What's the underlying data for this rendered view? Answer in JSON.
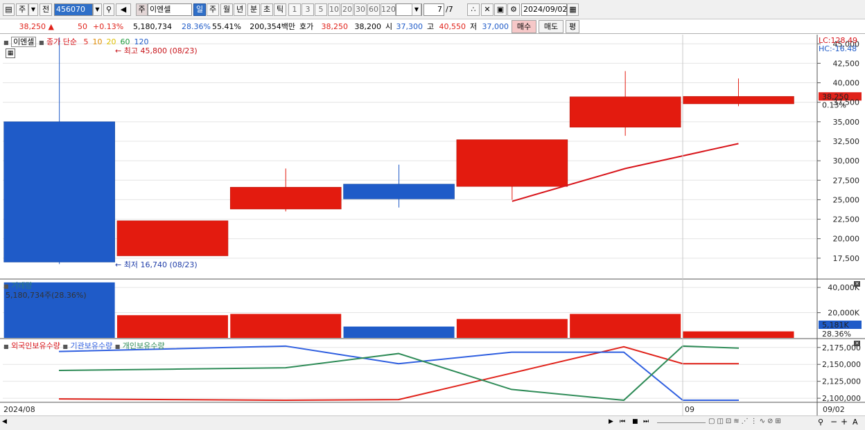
{
  "toolbar": {
    "market_mode": "주",
    "prev_label": "전",
    "stock_code": "456070",
    "stock_prefix": "주",
    "stock_name": "이엔셀",
    "periods": [
      "일",
      "주",
      "월",
      "년",
      "분",
      "초",
      "틱"
    ],
    "selected_period": "일",
    "intervals": [
      "1",
      "3",
      "5",
      "10",
      "20",
      "30",
      "60",
      "120"
    ],
    "page": "7",
    "page_total": "/7",
    "date": "2024/09/02"
  },
  "quote": {
    "price": "38,250 ▲",
    "change": "50",
    "change_pct": "+0.13%",
    "volume": "5,180,734",
    "turnover_pct": "28.36%",
    "ratio_pct": "55.41%",
    "amount": "200,354백만",
    "ask_label": "호가",
    "ask": "38,250",
    "bid": "38,200",
    "open_label": "시",
    "open": "37,300",
    "high_label": "고",
    "high": "40,550",
    "low_label": "저",
    "low": "37,000",
    "buy_label": "매수",
    "sell_label": "매도",
    "eval_label": "평"
  },
  "price_panel": {
    "stock_name": "이엔셀",
    "legend_ma": "종가 단순",
    "ma_periods": [
      "5",
      "10",
      "20",
      "60",
      "120"
    ],
    "ma_colors": [
      "#e0221a",
      "#e08a00",
      "#e0c000",
      "#1a9a3a",
      "#1f5bc8"
    ],
    "high_note": "최고 45,800 (08/23)",
    "low_note": "최저 16,740 (08/23)",
    "lc": "LC:128.49",
    "hc": "HC:-16.48",
    "last_price_tag": "38,250",
    "last_change_tag": "0.13%",
    "y_ticks": [
      "45,000",
      "42,500",
      "40,000",
      "37,500",
      "35,000",
      "32,500",
      "30,000",
      "27,500",
      "25,000",
      "22,500",
      "20,000",
      "17,500"
    ]
  },
  "volume_panel": {
    "title": "거래량",
    "info": "5,180,734주(28.36%)",
    "y_ticks": [
      "40,000K",
      "20,000K"
    ],
    "last_tag": "5,181K",
    "last_pct": "28.36%"
  },
  "holding_panel": {
    "legend": [
      "외국인보유수량",
      "기관보유수량",
      "개인보유수량"
    ],
    "y_ticks": [
      "2,175,000",
      "2,150,000",
      "2,125,000",
      "2,100,000"
    ]
  },
  "x_axis": {
    "left_label": "2024/08",
    "mid_label": "09",
    "right_label": "09/02"
  },
  "colors": {
    "up": "#e31b0f",
    "down": "#1f5bc8",
    "foreign": "#e0221a",
    "inst": "#2f5fe0",
    "indiv": "#2e8b57",
    "ma5": "#d8141a"
  },
  "chart_data": [
    {
      "type": "candlestick",
      "title": "이엔셀",
      "ylim": [
        15000,
        46000
      ],
      "candles": [
        {
          "open": 35000,
          "close": 17000,
          "high": 45800,
          "low": 16740
        },
        {
          "open": 17800,
          "close": 22300,
          "high": 22300,
          "low": 17800
        },
        {
          "open": 23800,
          "close": 26600,
          "high": 29000,
          "low": 23500
        },
        {
          "open": 27000,
          "close": 25100,
          "high": 29500,
          "low": 24000
        },
        {
          "open": 26700,
          "close": 32700,
          "high": 32700,
          "low": 25000
        },
        {
          "open": 34300,
          "close": 38200,
          "high": 41500,
          "low": 33200
        },
        {
          "open": 37300,
          "close": 38250,
          "high": 40550,
          "low": 37000
        }
      ],
      "ma5": [
        null,
        null,
        null,
        null,
        24800,
        29000,
        32200
      ]
    },
    {
      "type": "bar",
      "title": "거래량",
      "unit": "K",
      "ylim": [
        0,
        45000
      ],
      "values": [
        44000,
        18000,
        19000,
        9000,
        15000,
        19000,
        5181
      ],
      "directions": [
        "down",
        "up",
        "up",
        "down",
        "up",
        "up",
        "up"
      ]
    },
    {
      "type": "line",
      "ylim": [
        2095000,
        2185000
      ],
      "series": [
        {
          "name": "외국인보유수량",
          "values": [
            2099000,
            2098000,
            2097000,
            2098000,
            2137000,
            2176000,
            2151000,
            2151000
          ]
        },
        {
          "name": "기관보유수량",
          "values": [
            2169000,
            2173000,
            2177000,
            2151000,
            2168000,
            2168000,
            2097000,
            2097000
          ]
        },
        {
          "name": "개인보유수량",
          "values": [
            2141000,
            2143000,
            2145000,
            2166000,
            2113000,
            2097000,
            2177000,
            2174000
          ]
        }
      ]
    }
  ]
}
